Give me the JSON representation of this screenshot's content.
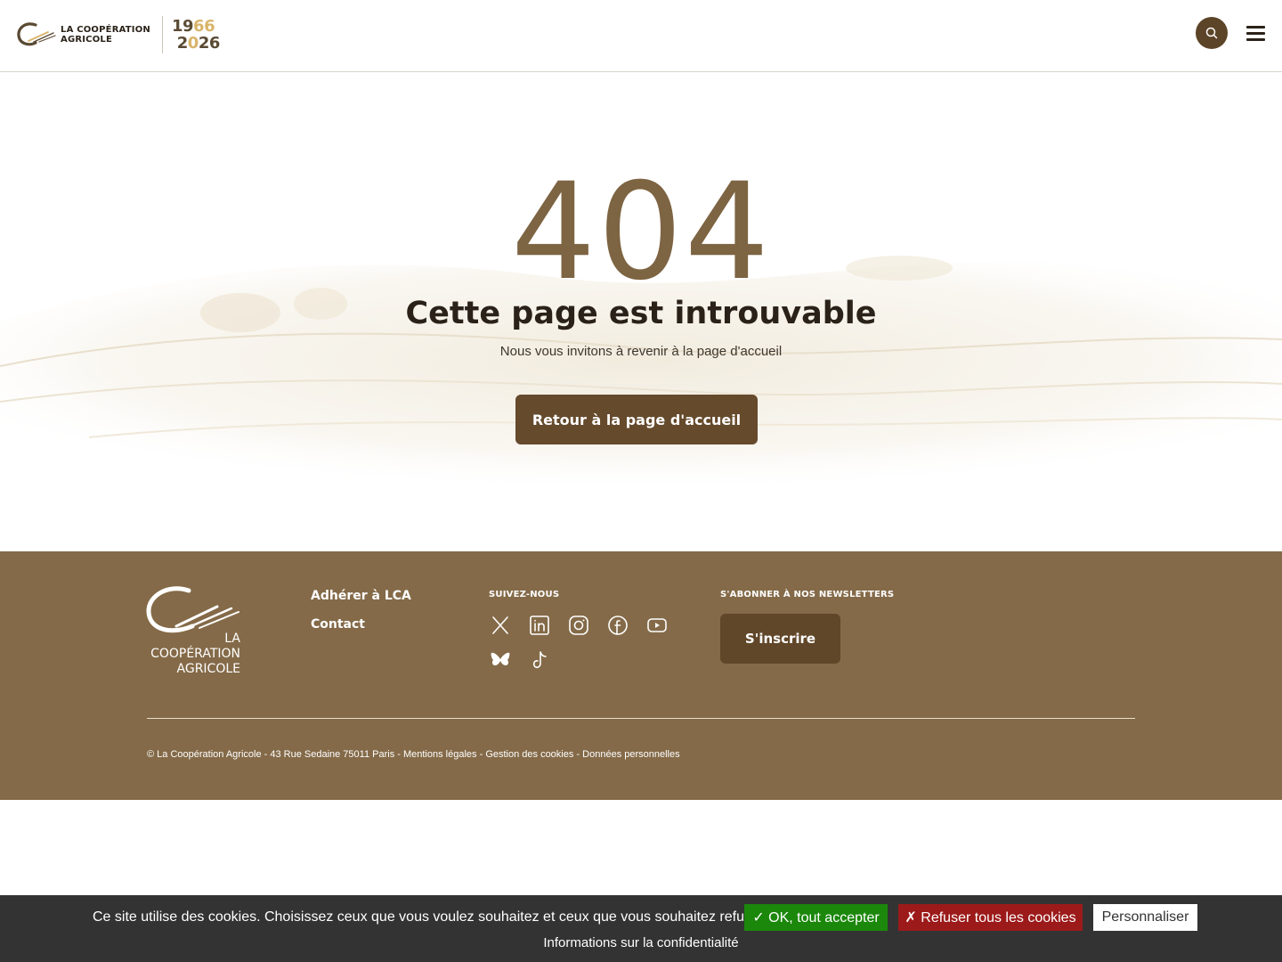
{
  "header": {
    "logo_line1": "LA COOPÉRATION",
    "logo_line2": "AGRICOLE",
    "years_top_a": "19",
    "years_top_b": "66",
    "years_bottom_a": "2",
    "years_bottom_b": "0",
    "years_bottom_c": "26",
    "search_icon": "search-icon",
    "menu_icon": "hamburger-menu-icon"
  },
  "hero": {
    "code": "404",
    "title": "Cette page est introuvable",
    "subtitle": "Nous vous invitons à revenir à la page d'accueil",
    "button_label": "Retour à la page d'accueil"
  },
  "footer": {
    "logo_line1": "LA",
    "logo_line2": "COOPÉRATION",
    "logo_line3": "AGRICOLE",
    "links": [
      "Adhérer à LCA",
      "Contact"
    ],
    "follow_heading": "SUIVEZ-NOUS",
    "socials": [
      "x-icon",
      "linkedin-icon",
      "instagram-icon",
      "facebook-icon",
      "youtube-icon",
      "bluesky-icon",
      "tiktok-icon"
    ],
    "newsletter_heading": "S'ABONNER À NOS NEWSLETTERS",
    "subscribe_label": "S'inscrire",
    "legal_prefix": "© La Coopération Agricole - 43 Rue Sedaine 75011 Paris - ",
    "legal_mentions": "Mentions légales",
    "legal_sep1": " - ",
    "legal_cookies": "Gestion des cookies",
    "legal_sep2": " - ",
    "legal_data": "Données personnelles"
  },
  "cookie_bar": {
    "text": "Ce site utilise des cookies. Choisissez ceux que vous voulez souhaitez et ceux que vous souhaitez refuser.",
    "accept_label": "✓ OK, tout accepter",
    "deny_label": "✗ Refuser tous les cookies",
    "customize_label": "Personnaliser",
    "info_label": "Informations sur la confidentialité"
  },
  "colors": {
    "brand_brown": "#846a48",
    "button_brown": "#654a2c",
    "accent_gold": "#d9b46a",
    "accept_green": "#1b870b",
    "deny_red": "#9c1a1a"
  }
}
